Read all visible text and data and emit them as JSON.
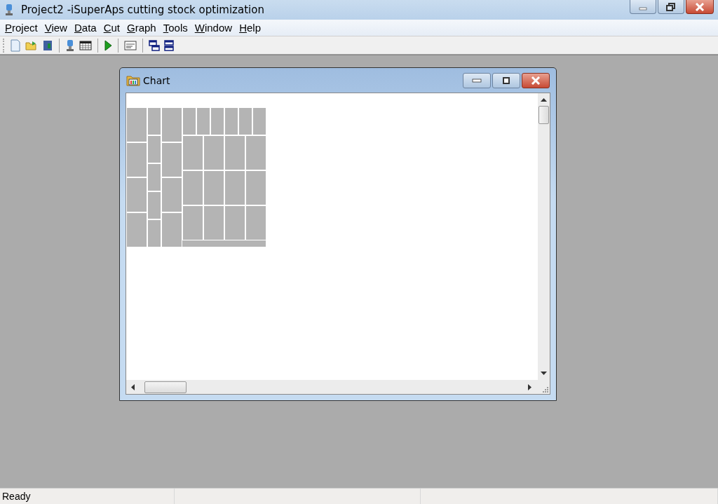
{
  "window": {
    "title": "Project2 -iSuperAps cutting stock optimization"
  },
  "menu": [
    "Project",
    "View",
    "Data",
    "Cut",
    "Graph",
    "Tools",
    "Window",
    "Help"
  ],
  "child_window": {
    "title": "Chart"
  },
  "status_bar": {
    "text": "Ready"
  }
}
